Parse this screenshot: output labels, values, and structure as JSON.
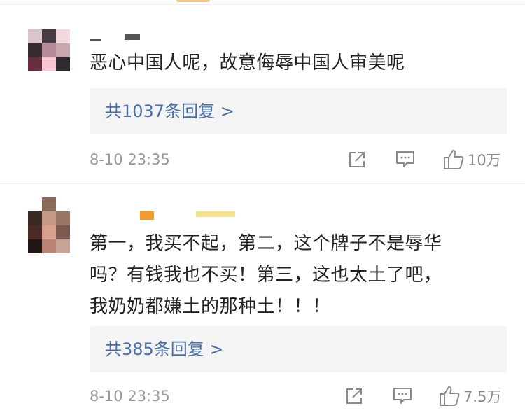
{
  "comments": [
    {
      "text": "恶心中国人呢，故意侮辱中国人审美呢",
      "replies_label": "共1037条回复 >",
      "time": "8-10 23:35",
      "likes": "10万",
      "avatar_colors": [
        "#d9c6cc",
        "#4a3c45",
        "#f2d9de",
        "#3a2a32",
        "#b88a98",
        "#c7a6ae",
        "#6a2f3d",
        "#f6c7d2",
        "#2e2a30"
      ]
    },
    {
      "text": "第一，我买不起，第二，这个牌子不是辱华\n吗？有钱我也不买！第三，这也太土了吧，\n我奶奶都嫌土的那种土！！！",
      "replies_label": "共385条回复 >",
      "time": "8-10 23:35",
      "likes": "7.5万",
      "avatar_colors": [
        "#ffffff",
        "#8a6a5a",
        "#ffffff",
        "#3b2a24",
        "#c49a86",
        "#9a7464",
        "#4a2a22",
        "#d8a08e",
        "#7a5a50",
        "#1f1614",
        "#b88478",
        "#c9a296"
      ]
    }
  ],
  "icons": {
    "share": "share-icon",
    "comment": "comment-icon",
    "like": "thumbs-up-icon"
  },
  "colors": {
    "link": "#4a6fa5",
    "meta": "#9a9a9a",
    "text": "#222222",
    "reply_bg": "#f4f4f4"
  }
}
